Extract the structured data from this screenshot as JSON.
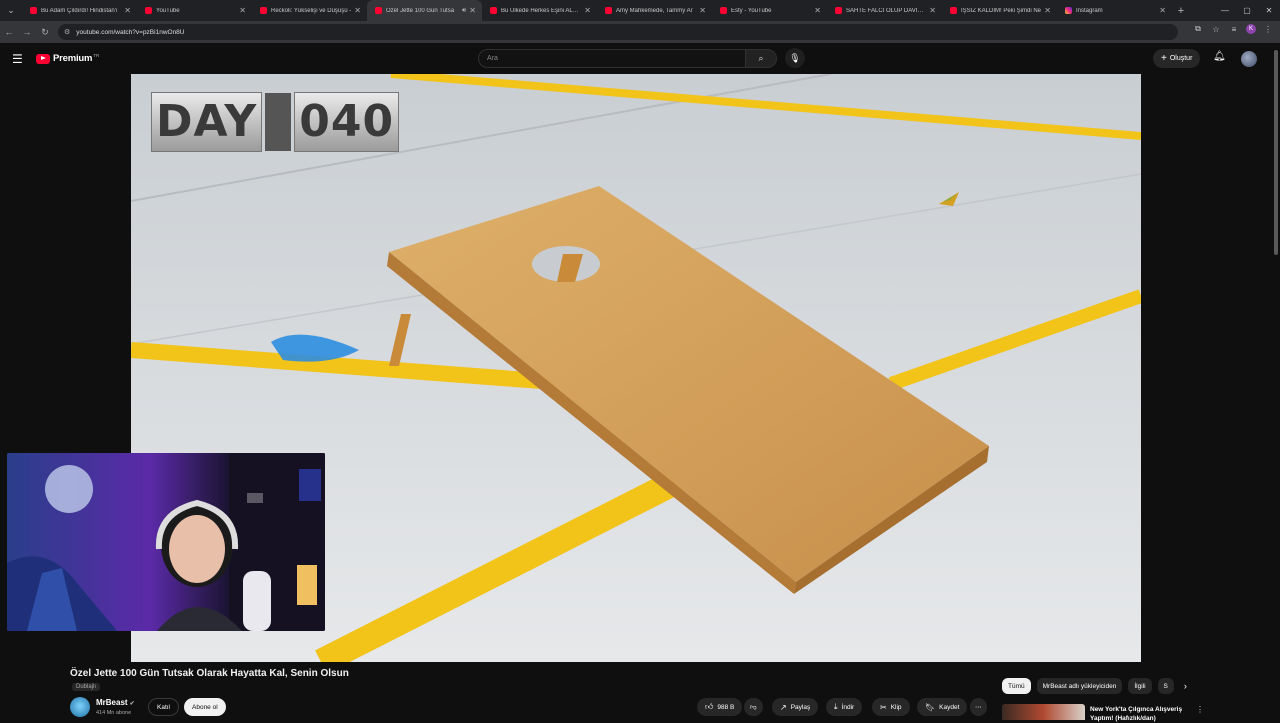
{
  "browser": {
    "tabs": [
      {
        "label": "Bu Adam Çıldırdı! Hindistan'ı",
        "icon": "youtube-icon",
        "active": false
      },
      {
        "label": "YouTube",
        "icon": "youtube-icon",
        "active": false
      },
      {
        "label": "Reckoli: Yükselişi ve Düşüşü -",
        "icon": "youtube-icon",
        "active": false
      },
      {
        "label": "Özel Jette 100 Gün Tutsa",
        "icon": "youtube-icon",
        "active": true
      },
      {
        "label": "Bu Ülkede Herkes Eşini ALDAT",
        "icon": "youtube-icon",
        "active": false
      },
      {
        "label": "Amy Mahkemede, Tammy Ar",
        "icon": "youtube-icon",
        "active": false
      },
      {
        "label": "Esty - YouTube",
        "icon": "youtube-icon",
        "active": false
      },
      {
        "label": "SAHTE FALCI OLUP DAVILAR",
        "icon": "youtube-icon",
        "active": false
      },
      {
        "label": "İŞSİZ KALDIM! Peki Şimdi Ne",
        "icon": "youtube-icon",
        "active": false
      },
      {
        "label": "Instagram",
        "icon": "instagram-icon",
        "active": false
      }
    ],
    "url": "youtube.com/watch?v=pzBi1nwOn8U",
    "profile_initial": "K"
  },
  "youtube": {
    "logo_text": "Premium",
    "logo_region": "TR",
    "search_placeholder": "Ara",
    "create_label": "Oluştur"
  },
  "player": {
    "overlay_day_word": "DAY",
    "overlay_day_number": "040"
  },
  "video": {
    "title": "Özel Jette 100 Gün Tutsak Olarak Hayatta Kal, Senin Olsun",
    "dub_label": "Dublajlı",
    "channel_name": "MrBeast",
    "subscribers": "414 Mn abone",
    "join_label": "Katıl",
    "subscribe_label": "Abone ol",
    "likes": "988 B",
    "share_label": "Paylaş",
    "download_label": "İndir",
    "clip_label": "Klip",
    "save_label": "Kaydet"
  },
  "sidebar": {
    "chips": [
      "Tümü",
      "MrBeast adlı yükleyiciden",
      "İlgili",
      "S"
    ],
    "recommendation_title": "New York'ta Çılgınca Alışveriş Yaptım! (Hafızlık/dan)"
  },
  "colors": {
    "background": "#0f0f0f",
    "youtube_red": "#ff0033",
    "court_yellow": "#f2c318",
    "board_wood": "#d4a35c"
  }
}
